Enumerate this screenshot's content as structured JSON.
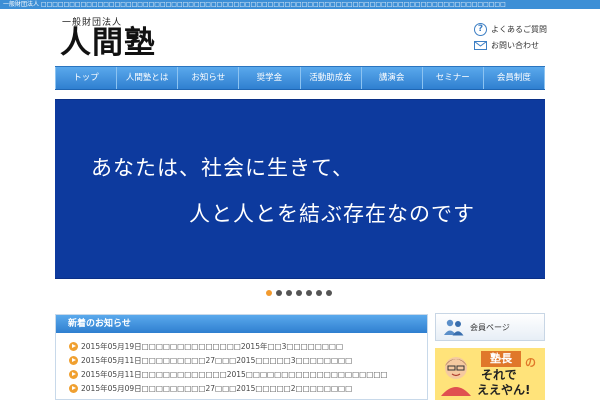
{
  "topbar": {
    "text": "一般財団法人 □□□□□□□□□□□□□□□□□□□□□□□□□□□□□□□□□□□□□□□□□□□□□□□□□□□□□□□□□□□□□□□□□□□□□□□□□□□□□□□□□□"
  },
  "header": {
    "logo_subtitle": "一般財団法人",
    "logo_title": "人間塾",
    "faq_label": "よくあるご質問",
    "contact_label": "お問い合わせ"
  },
  "nav": {
    "items": [
      {
        "label": "トップ"
      },
      {
        "label": "人間塾とは"
      },
      {
        "label": "お知らせ"
      },
      {
        "label": "奨学金"
      },
      {
        "label": "活動助成金"
      },
      {
        "label": "講演会"
      },
      {
        "label": "セミナー"
      },
      {
        "label": "会員制度"
      }
    ]
  },
  "banner": {
    "line1": "あなたは、社会に生きて、",
    "line2": "人と人とを結ぶ存在なのです"
  },
  "carousel": {
    "slide_count": 7,
    "active_index": 0
  },
  "news": {
    "title": "新着のお知らせ",
    "items": [
      {
        "text": "2015年05月19日□□□□□□□□□□□□□□2015年□□3□□□□□□□□"
      },
      {
        "text": "2015年05月11日□□□□□□□□□27□□□2015□□□□□3□□□□□□□□"
      },
      {
        "text": "2015年05月11日□□□□□□□□□□□□2015□□□□□□□□□□□□□□□□□□□□"
      },
      {
        "text": "2015年05月09日□□□□□□□□□27□□□2015□□□□□2□□□□□□□□"
      }
    ]
  },
  "sidebar": {
    "member_label": "会員ページ",
    "promo": {
      "line1": "塾長",
      "line1b": "の",
      "line2": "それで",
      "line3": "ええやん!"
    }
  },
  "colors": {
    "accent": "#3d8fd6",
    "banner": "#0d3a9e",
    "active_dot": "#f29a2e",
    "promo_bg": "#ffe37a"
  }
}
